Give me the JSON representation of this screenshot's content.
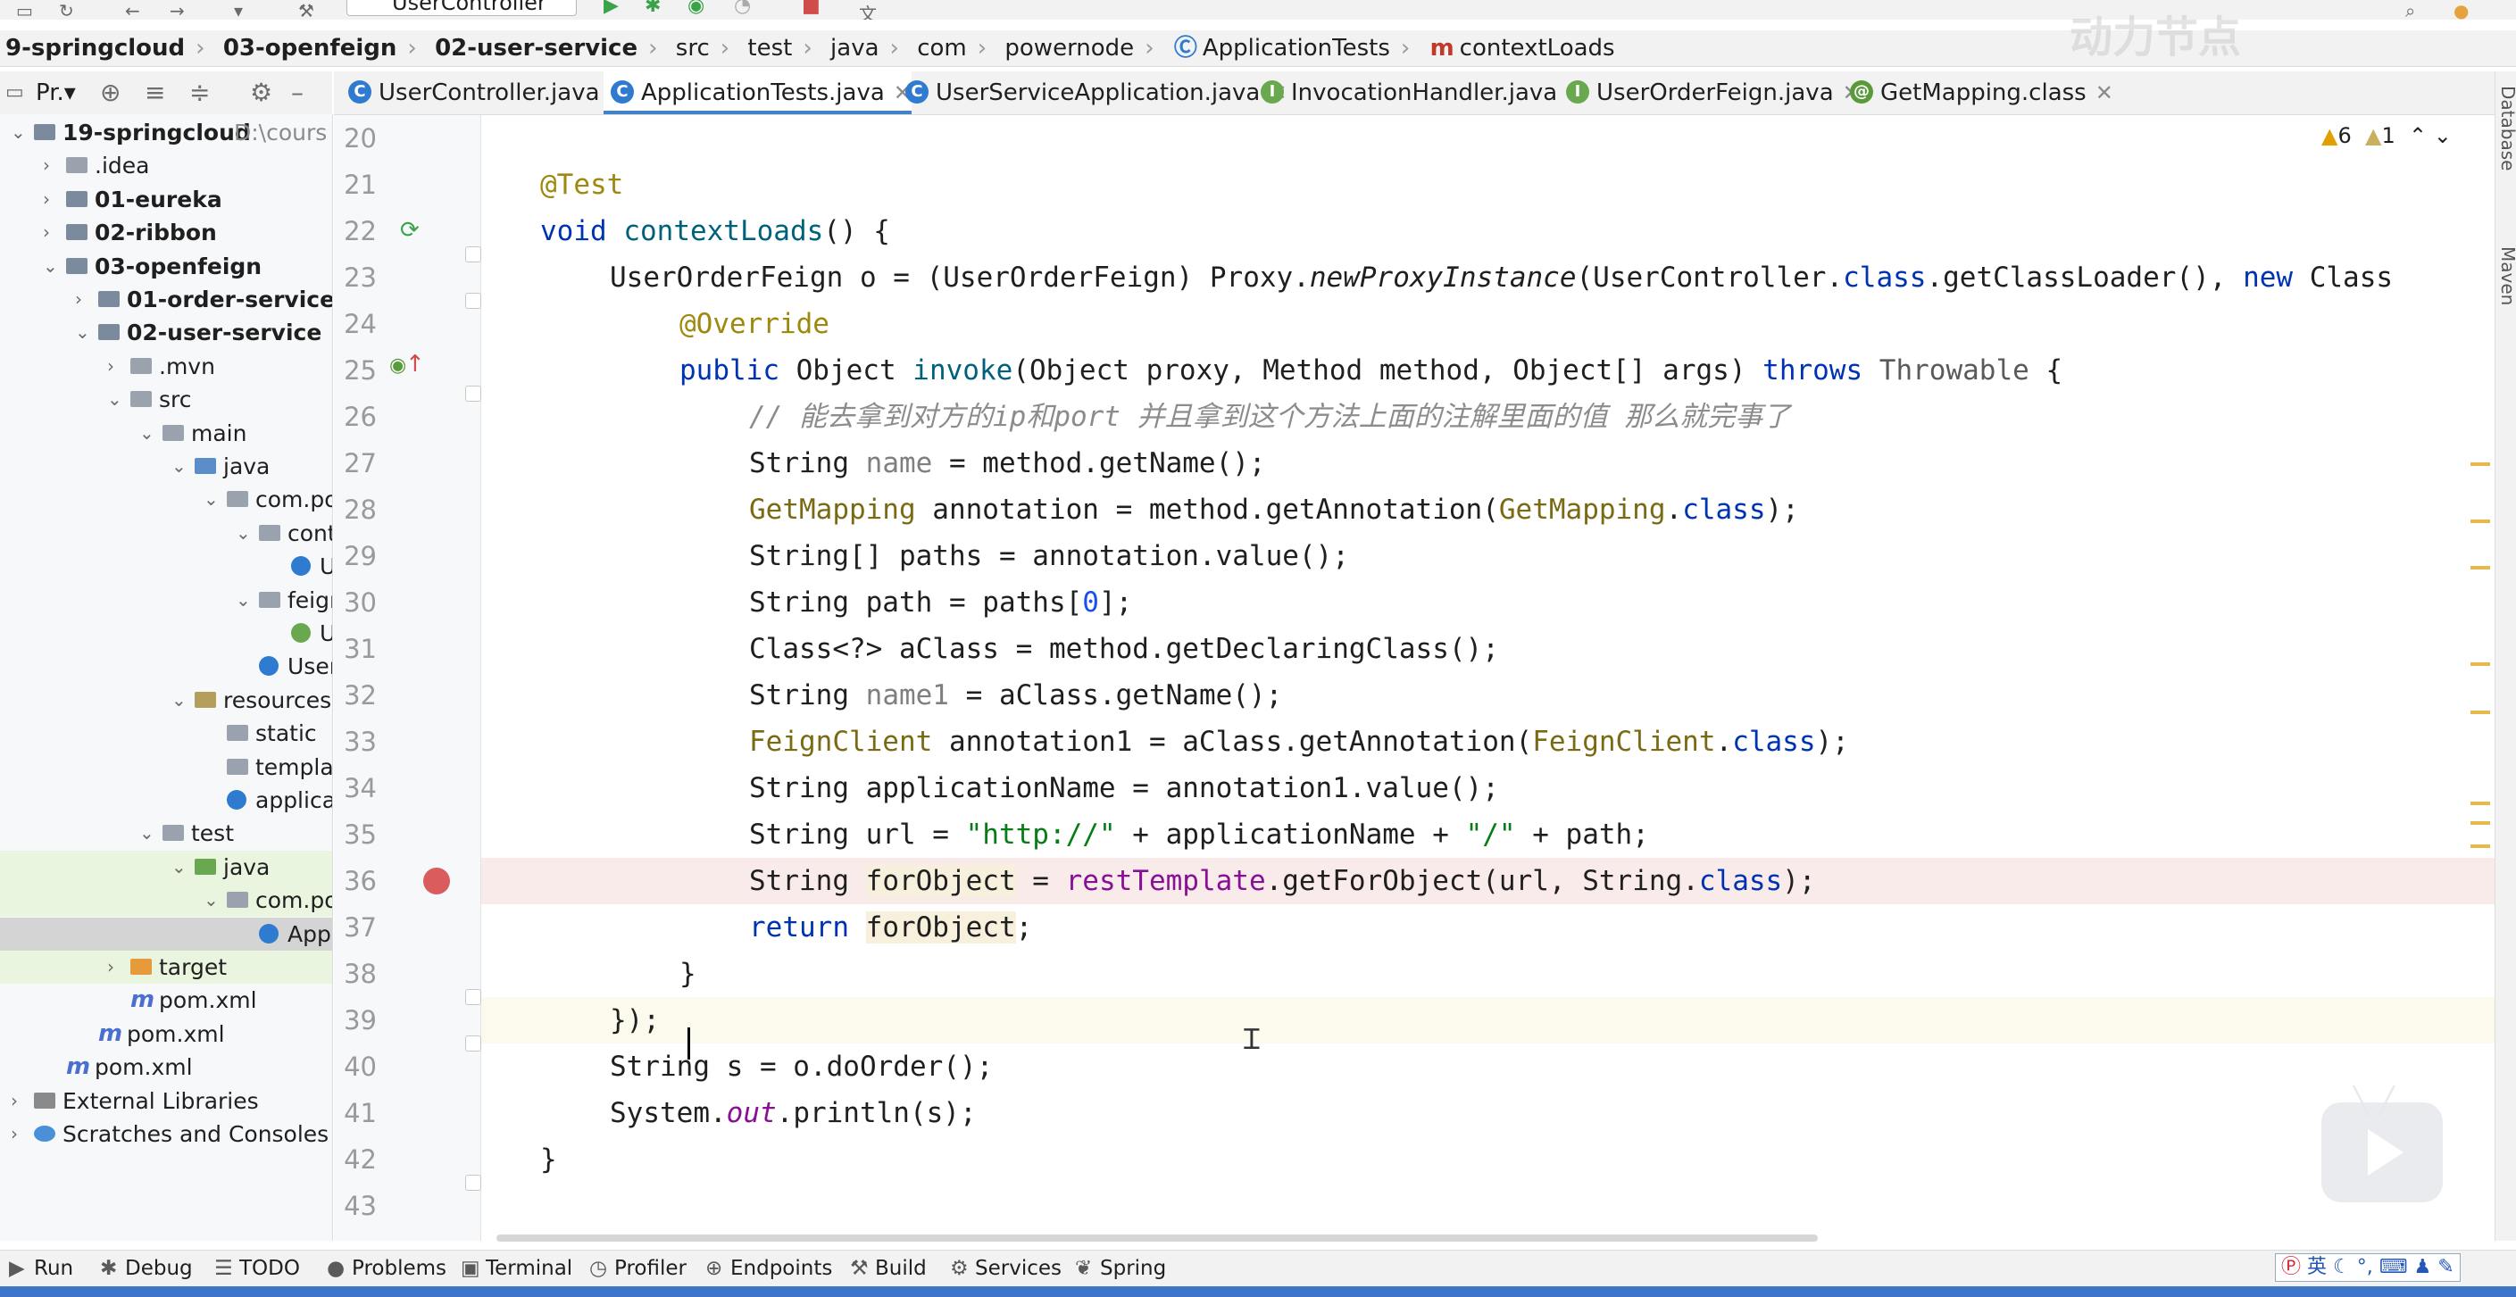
{
  "toolbar": {
    "run_config": "UserController"
  },
  "watermark": "动力节点",
  "breadcrumb": [
    {
      "label": "9-springcloud",
      "bold": true
    },
    {
      "label": "03-openfeign",
      "bold": true
    },
    {
      "label": "02-user-service",
      "bold": true
    },
    {
      "label": "src",
      "bold": false
    },
    {
      "label": "test",
      "bold": false
    },
    {
      "label": "java",
      "bold": false
    },
    {
      "label": "com",
      "bold": false
    },
    {
      "label": "powernode",
      "bold": false
    },
    {
      "label": "ApplicationTests",
      "bold": false,
      "icon": "class-icon"
    },
    {
      "label": "contextLoads",
      "bold": false,
      "icon": "method-icon"
    }
  ],
  "project_panel": {
    "title": "Pr.▾"
  },
  "tabs": [
    {
      "label": "UserController.java",
      "kind": "class",
      "active": false
    },
    {
      "label": "ApplicationTests.java",
      "kind": "class",
      "active": true
    },
    {
      "label": "UserServiceApplication.java",
      "kind": "class",
      "active": false
    },
    {
      "label": "InvocationHandler.java",
      "kind": "interface",
      "active": false
    },
    {
      "label": "UserOrderFeign.java",
      "kind": "interface",
      "active": false
    },
    {
      "label": "GetMapping.class",
      "kind": "annotation",
      "active": false
    }
  ],
  "tree": [
    {
      "label": "19-springcloud",
      "path": "D:\\cours",
      "bold": true,
      "indent": 0,
      "arrow": "open",
      "icon": "mod"
    },
    {
      "label": ".idea",
      "indent": 1,
      "arrow": "closed",
      "icon": "dir"
    },
    {
      "label": "01-eureka",
      "bold": true,
      "indent": 1,
      "arrow": "closed",
      "icon": "mod"
    },
    {
      "label": "02-ribbon",
      "bold": true,
      "indent": 1,
      "arrow": "closed",
      "icon": "mod"
    },
    {
      "label": "03-openfeign",
      "bold": true,
      "indent": 1,
      "arrow": "open",
      "icon": "mod"
    },
    {
      "label": "01-order-service",
      "bold": true,
      "indent": 2,
      "arrow": "closed",
      "icon": "mod"
    },
    {
      "label": "02-user-service",
      "bold": true,
      "indent": 2,
      "arrow": "open",
      "icon": "mod"
    },
    {
      "label": ".mvn",
      "indent": 3,
      "arrow": "closed",
      "icon": "dir"
    },
    {
      "label": "src",
      "indent": 3,
      "arrow": "open",
      "icon": "dir"
    },
    {
      "label": "main",
      "indent": 4,
      "arrow": "open",
      "icon": "dir"
    },
    {
      "label": "java",
      "indent": 5,
      "arrow": "open",
      "icon": "src"
    },
    {
      "label": "com.pov",
      "indent": 6,
      "arrow": "open",
      "icon": "pkg"
    },
    {
      "label": "contr",
      "indent": 7,
      "arrow": "open",
      "icon": "pkg"
    },
    {
      "label": "Us",
      "indent": 8,
      "arrow": "none",
      "icon": "cfile"
    },
    {
      "label": "feign",
      "indent": 7,
      "arrow": "open",
      "icon": "pkg"
    },
    {
      "label": "Us",
      "indent": 8,
      "arrow": "none",
      "icon": "ifile"
    },
    {
      "label": "UserS",
      "indent": 7,
      "arrow": "none",
      "icon": "cfile"
    },
    {
      "label": "resources",
      "indent": 5,
      "arrow": "open",
      "icon": "res"
    },
    {
      "label": "static",
      "indent": 6,
      "arrow": "none",
      "icon": "dir"
    },
    {
      "label": "templat",
      "indent": 6,
      "arrow": "none",
      "icon": "dir"
    },
    {
      "label": "applicat",
      "indent": 6,
      "arrow": "none",
      "icon": "cfile"
    },
    {
      "label": "test",
      "indent": 4,
      "arrow": "open",
      "icon": "dir"
    },
    {
      "label": "java",
      "indent": 5,
      "arrow": "open",
      "icon": "test",
      "highlight": true
    },
    {
      "label": "com.pov",
      "indent": 6,
      "arrow": "open",
      "icon": "pkg",
      "highlight": true
    },
    {
      "label": "Appli",
      "indent": 7,
      "arrow": "none",
      "icon": "cfile",
      "selected": true
    },
    {
      "label": "target",
      "indent": 3,
      "arrow": "closed",
      "icon": "target",
      "highlight": true
    },
    {
      "label": "pom.xml",
      "indent": 3,
      "arrow": "none",
      "icon": "mvn"
    },
    {
      "label": "pom.xml",
      "indent": 2,
      "arrow": "none",
      "icon": "mvn"
    },
    {
      "label": "pom.xml",
      "indent": 1,
      "arrow": "none",
      "icon": "mvn"
    },
    {
      "label": "External Libraries",
      "indent": 0,
      "arrow": "closed",
      "icon": "lib"
    },
    {
      "label": "Scratches and Consoles",
      "indent": 0,
      "arrow": "closed",
      "icon": "scr"
    }
  ],
  "inspections": {
    "warnings": "6",
    "weak_warnings": "1"
  },
  "code": {
    "line_numbers": [
      "20",
      "21",
      "22",
      "23",
      "24",
      "25",
      "26",
      "27",
      "28",
      "29",
      "30",
      "31",
      "32",
      "33",
      "34",
      "35",
      "36",
      "37",
      "38",
      "39",
      "40",
      "41",
      "42",
      "43"
    ],
    "l21": "@Test",
    "l22_kw": "void",
    "l22_fn": "contextLoads",
    "l22_rest": "() {",
    "l23_a": "UserOrderFeign o = (UserOrderFeign) Proxy.",
    "l23_m": "newProxyInstance",
    "l23_b": "(UserController.",
    "l23_k": "class",
    "l23_c": ".getClassLoader(), ",
    "l23_k2": "new",
    "l23_d": " Class",
    "l24": "@Override",
    "l25_k": "public",
    "l25_a": " Object ",
    "l25_fn": "invoke",
    "l25_b": "(Object proxy, Method method, Object[] args) ",
    "l25_k2": "throws",
    "l25_c": " Throwable",
    "l25_d": " {",
    "l26": "// 能去拿到对方的ip和port 并且拿到这个方法上面的注解里面的值 那么就完事了",
    "l27_a": "String ",
    "l27_v": "name",
    "l27_b": " = method.getName();",
    "l28_t": "GetMapping",
    "l28_a": " annotation = method.getAnnotation(",
    "l28_t2": "GetMapping",
    "l28_b": ".",
    "l28_k": "class",
    "l28_c": ");",
    "l29": "String[] paths = annotation.value();",
    "l30_a": "String path = paths[",
    "l30_n": "0",
    "l30_b": "];",
    "l31": "Class<?> aClass = method.getDeclaringClass();",
    "l32_a": "String ",
    "l32_v": "name1",
    "l32_b": " = aClass.getName();",
    "l33_t": "FeignClient",
    "l33_a": " annotation1 = aClass.getAnnotation(",
    "l33_t2": "FeignClient",
    "l33_b": ".",
    "l33_k": "class",
    "l33_c": ");",
    "l34": "String applicationName = annotation1.value();",
    "l35_a": "String url = ",
    "l35_s": "\"http://\"",
    "l35_b": " + applicationName + ",
    "l35_s2": "\"/\"",
    "l35_c": " + path;",
    "l36_a": "String ",
    "l36_v": "forObject",
    "l36_b": " = ",
    "l36_f": "restTemplate",
    "l36_c": ".getForObject(url, String.",
    "l36_k": "class",
    "l36_d": ");",
    "l37_k": "return",
    "l37_sp": " ",
    "l37_v": "forObject",
    "l37_e": ";",
    "l38": "}",
    "l39": "});",
    "l40": "String s = o.doOrder();",
    "l41_a": "System.",
    "l41_f": "out",
    "l41_b": ".println(s);",
    "l42": "}"
  },
  "bottom_tools": [
    {
      "label": "Run",
      "icon": "▶"
    },
    {
      "label": "Debug",
      "icon": "✱"
    },
    {
      "label": "TODO",
      "icon": "☰"
    },
    {
      "label": "Problems",
      "icon": "●"
    },
    {
      "label": "Terminal",
      "icon": "▣"
    },
    {
      "label": "Profiler",
      "icon": "◷"
    },
    {
      "label": "Endpoints",
      "icon": "⊕"
    },
    {
      "label": "Build",
      "icon": "⚒"
    },
    {
      "label": "Services",
      "icon": "⚙"
    },
    {
      "label": "Spring",
      "icon": "❦"
    }
  ],
  "ime": {
    "label": "英"
  },
  "right_strip": {
    "database": "Database",
    "maven": "Maven"
  }
}
